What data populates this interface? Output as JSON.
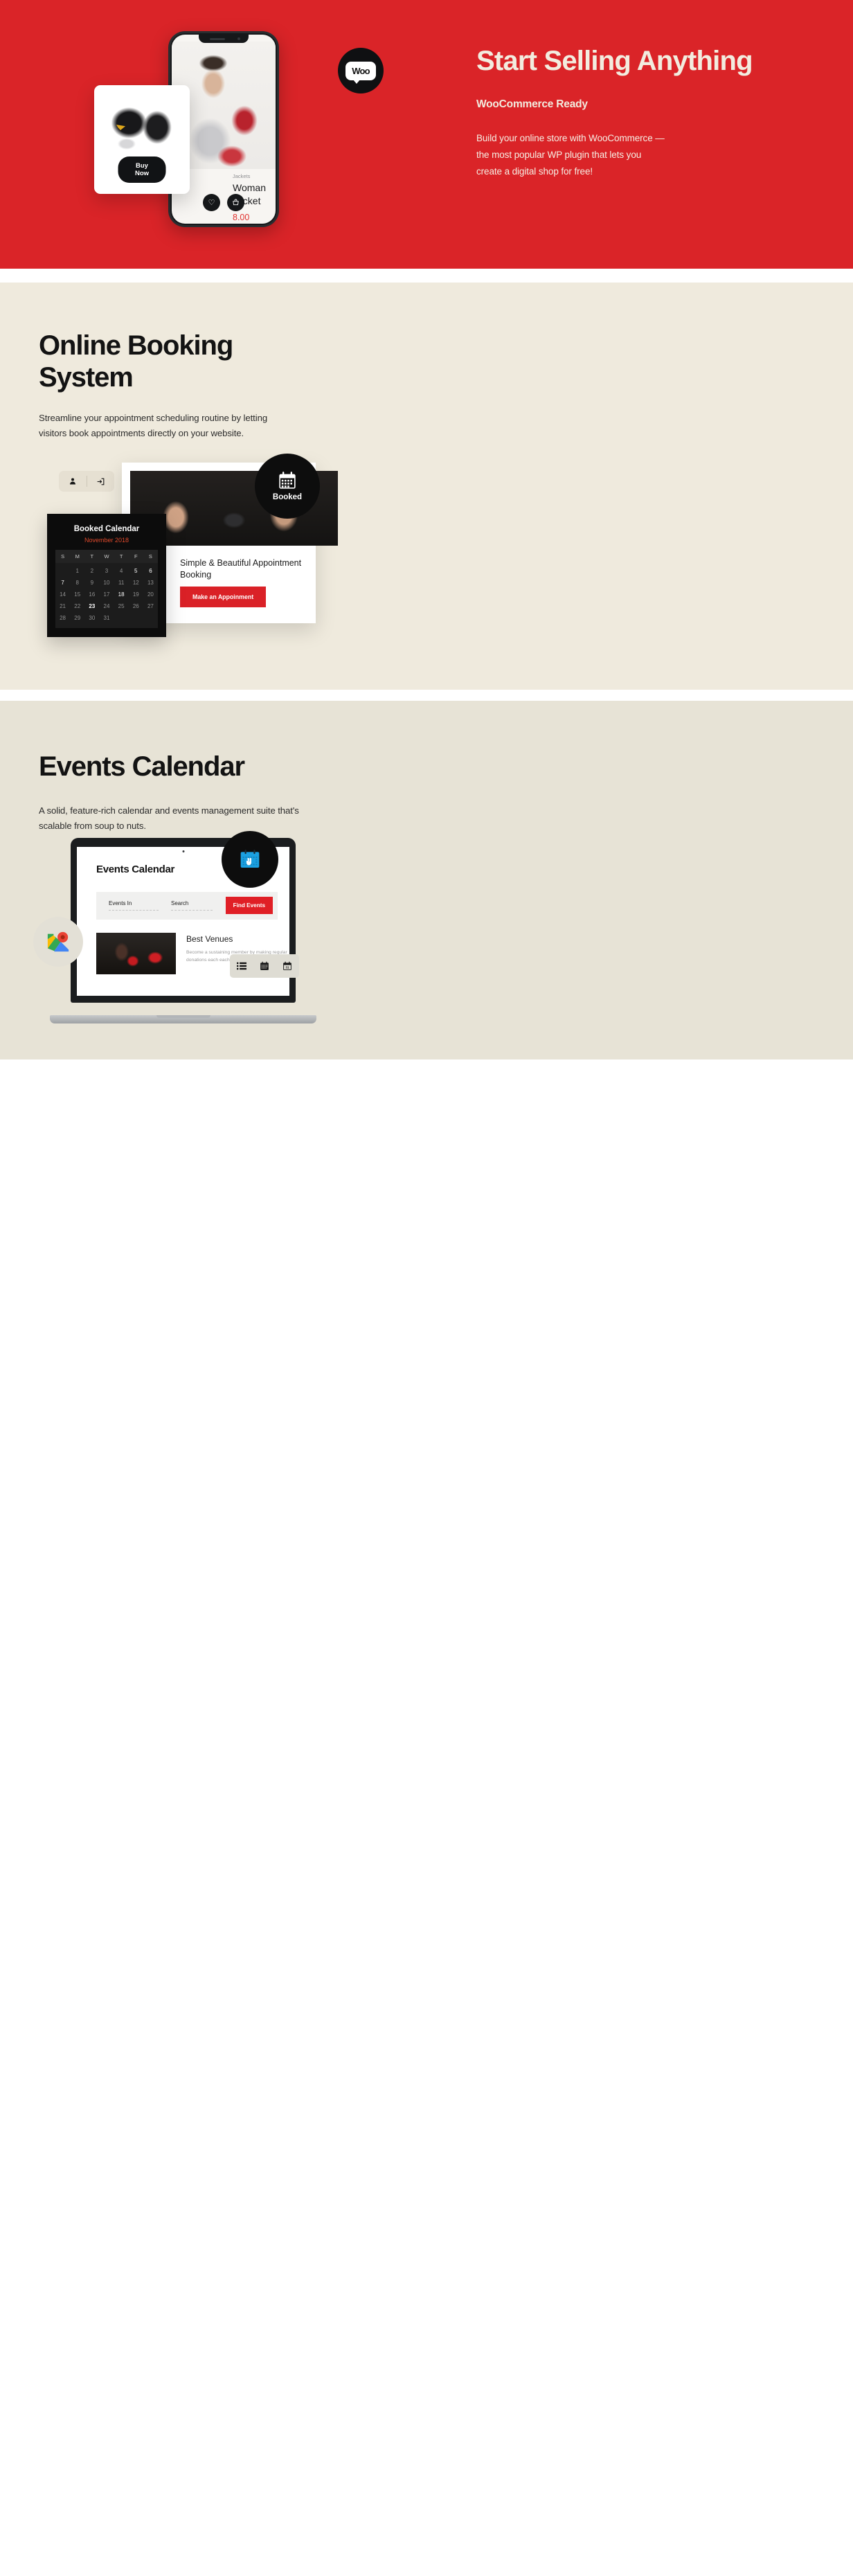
{
  "colors": {
    "hero_red": "#da2428",
    "cream": "#f2ecdf",
    "section_bg_1": "#efeadd",
    "section_bg_2": "#e7e3d6",
    "accent_red": "#e01f26",
    "dark": "#0d0d0d",
    "calendar_month_orange": "#e0492b"
  },
  "hero": {
    "title": "Start Selling Anything",
    "subtitle": "WooCommerce Ready",
    "body": "Build your online store with WooCommerce —  the most popular WP plugin that lets you create a digital shop for free!",
    "woo_badge_label": "Woo",
    "phone": {
      "category": "Jackets",
      "product_name": "Woman Jacket",
      "price": "8.00",
      "wishlist_icon": "heart-icon",
      "cart_icon": "basket-icon"
    },
    "product_card": {
      "buy_button": "Buy Now",
      "image_alt": "boxing-gloves-product-image"
    }
  },
  "booking": {
    "title": "Online Booking System",
    "description": "Streamline your appointment scheduling routine by letting visitors book appointments directly on your website.",
    "toolbar": {
      "user_icon": "user-icon",
      "login_icon": "login-arrow-icon"
    },
    "badge": {
      "label": "Booked",
      "icon": "calendar-icon"
    },
    "card": {
      "heading": "Simple & Beautiful Appointment Booking",
      "button": "Make an Appoinment",
      "image_alt": "two-boxers-facing-off"
    },
    "calendar": {
      "title": "Booked Calendar",
      "month": "November 2018",
      "weekdays": [
        "S",
        "M",
        "T",
        "W",
        "T",
        "F",
        "S"
      ],
      "leading_blanks": 1,
      "days": [
        1,
        2,
        3,
        4,
        5,
        6,
        7,
        8,
        9,
        10,
        11,
        12,
        13,
        14,
        15,
        16,
        17,
        18,
        19,
        20,
        21,
        22,
        23,
        24,
        25,
        26,
        27,
        28,
        29,
        30,
        31
      ],
      "highlighted_days": [
        5,
        6,
        7,
        18
      ],
      "selected_day": 23
    }
  },
  "events": {
    "title": "Events Calendar",
    "description": "A solid, feature-rich calendar and events management suite that's scalable from soup to nuts.",
    "badge_icon": "events-calendar-rock-hand-icon",
    "map_badge_icon": "google-maps-pin-icon",
    "view_switcher": {
      "list_icon": "list-view-icon",
      "month_icon": "month-view-icon",
      "day_icon": "day-view-icon"
    },
    "screen": {
      "title": "Events Calendar",
      "filter_events_in_label": "Events In",
      "filter_search_label": "Search",
      "find_button": "Find Events",
      "venue_title": "Best Venues",
      "venue_text": "Become a sustaining member by making regular donations each each month- you can use the f",
      "venue_image_alt": "woman-with-red-boxing-gloves"
    }
  }
}
